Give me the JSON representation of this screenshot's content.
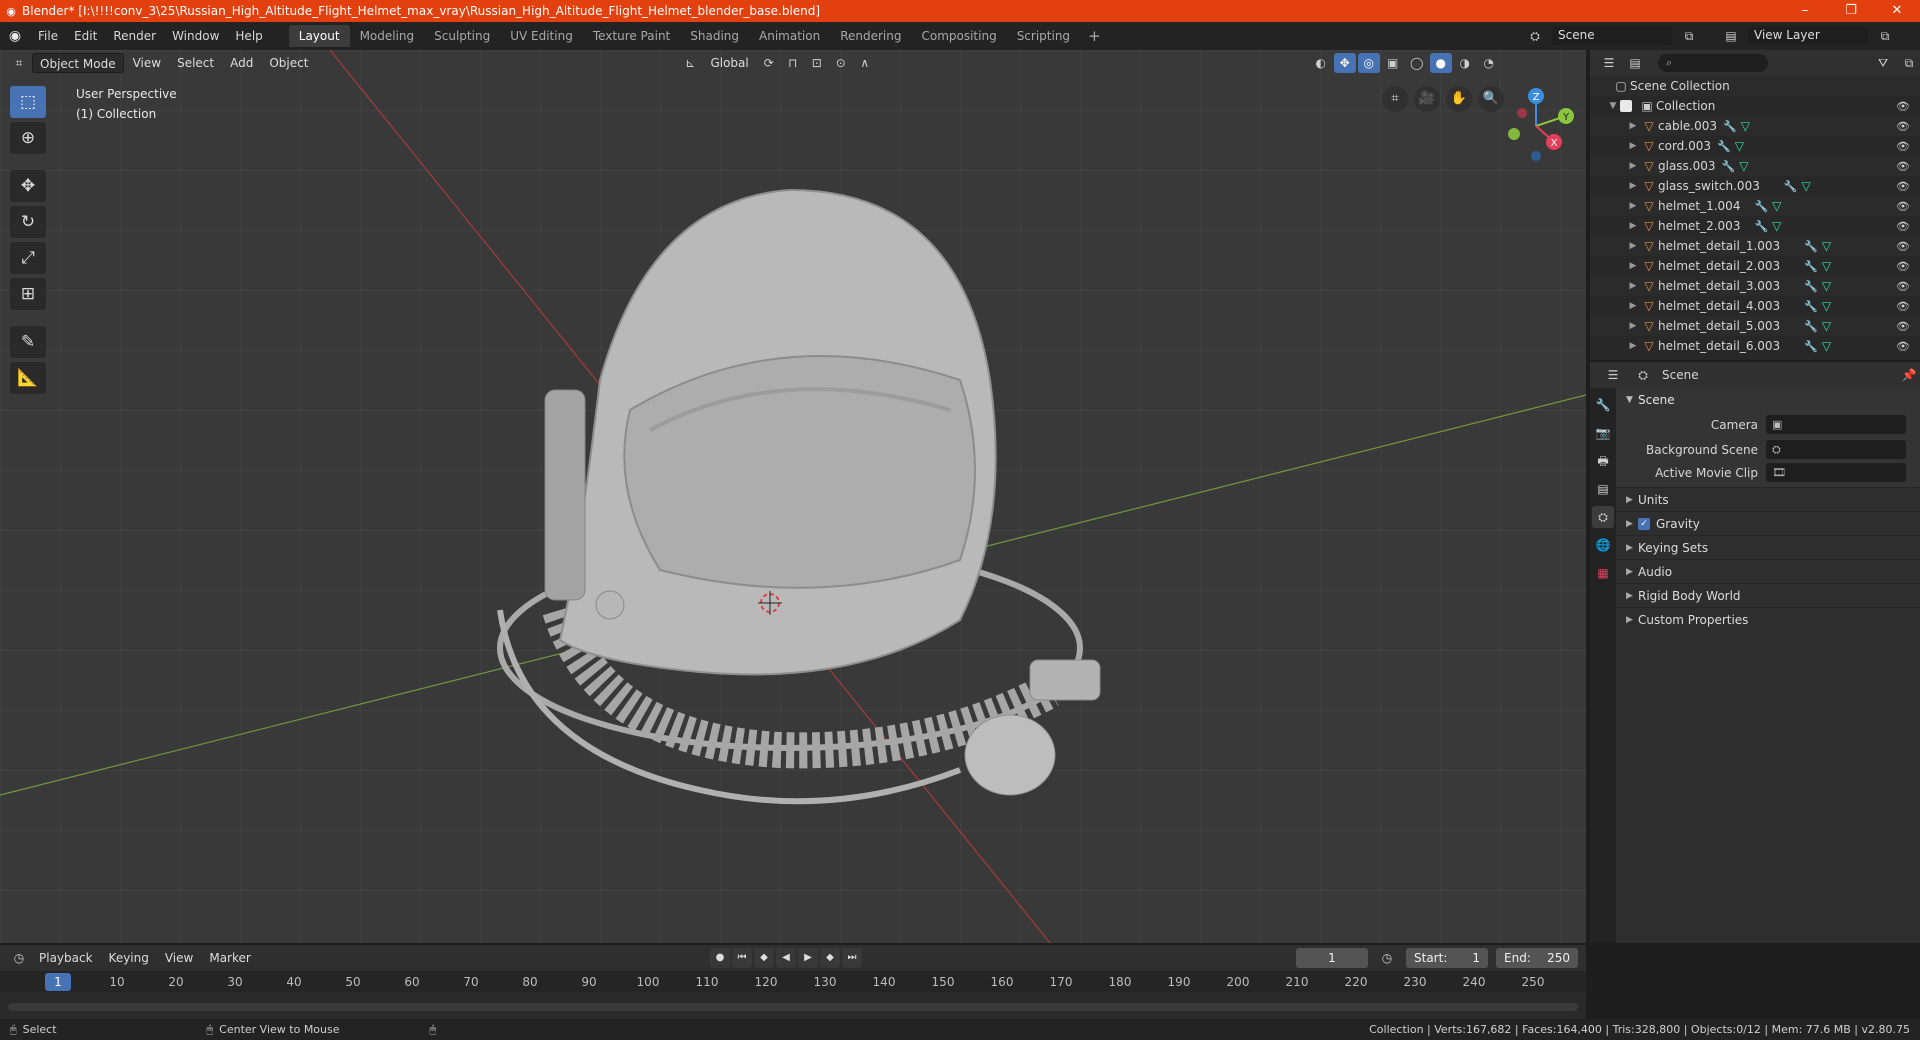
{
  "window": {
    "title": "Blender* [I:\\!!!!conv_3\\25\\Russian_High_Altitude_Flight_Helmet_max_vray\\Russian_High_Altitude_Flight_Helmet_blender_base.blend]",
    "minimize": "–",
    "maximize": "❐",
    "close": "✕"
  },
  "menubar": {
    "file": "File",
    "edit": "Edit",
    "render": "Render",
    "window": "Window",
    "help": "Help",
    "workspaces": [
      "Layout",
      "Modeling",
      "Sculpting",
      "UV Editing",
      "Texture Paint",
      "Shading",
      "Animation",
      "Rendering",
      "Compositing",
      "Scripting"
    ],
    "active_workspace": "Layout",
    "add_workspace": "+",
    "scene": "Scene",
    "view_layer": "View Layer"
  },
  "viewport": {
    "mode": "Object Mode",
    "menus": [
      "View",
      "Select",
      "Add",
      "Object"
    ],
    "transform_orientation": "Global",
    "info_line1": "User Perspective",
    "info_line2": "(1) Collection",
    "gizmo_axes": {
      "x": "X",
      "y": "Y",
      "z": "Z"
    }
  },
  "outliner": {
    "root": "Scene Collection",
    "collection": "Collection",
    "items": [
      "cable.003",
      "cord.003",
      "glass.003",
      "glass_switch.003",
      "helmet_1.004",
      "helmet_2.003",
      "helmet_detail_1.003",
      "helmet_detail_2.003",
      "helmet_detail_3.003",
      "helmet_detail_4.003",
      "helmet_detail_5.003",
      "helmet_detail_6.003"
    ]
  },
  "properties": {
    "header": "Scene",
    "panel": "Scene",
    "camera_label": "Camera",
    "background_scene_label": "Background Scene",
    "active_movie_clip_label": "Active Movie Clip",
    "subpanels": [
      "Units",
      "Gravity",
      "Keying Sets",
      "Audio",
      "Rigid Body World",
      "Custom Properties"
    ]
  },
  "timeline": {
    "menus": [
      "Playback",
      "Keying",
      "View",
      "Marker"
    ],
    "current_frame": "1",
    "start_label": "Start:",
    "start_value": "1",
    "end_label": "End:",
    "end_value": "250",
    "ticks": [
      "10",
      "20",
      "30",
      "40",
      "50",
      "60",
      "70",
      "80",
      "90",
      "100",
      "110",
      "120",
      "130",
      "140",
      "150",
      "160",
      "170",
      "180",
      "190",
      "200",
      "210",
      "220",
      "230",
      "240",
      "250"
    ]
  },
  "statusbar": {
    "select": "Select",
    "center_view": "Center View to Mouse",
    "stats": "Collection | Verts:167,682 | Faces:164,400 | Tris:328,800 | Objects:0/12 | Mem: 77.6 MB | v2.80.75"
  },
  "colors": {
    "titlebar": "#e2400f",
    "accent": "#4772b3",
    "object_icon": "#e9913a",
    "mesh_icon": "#2de0a2",
    "x_axis": "#e2405a",
    "y_axis": "#8bc53f",
    "z_axis": "#3c8de0"
  }
}
